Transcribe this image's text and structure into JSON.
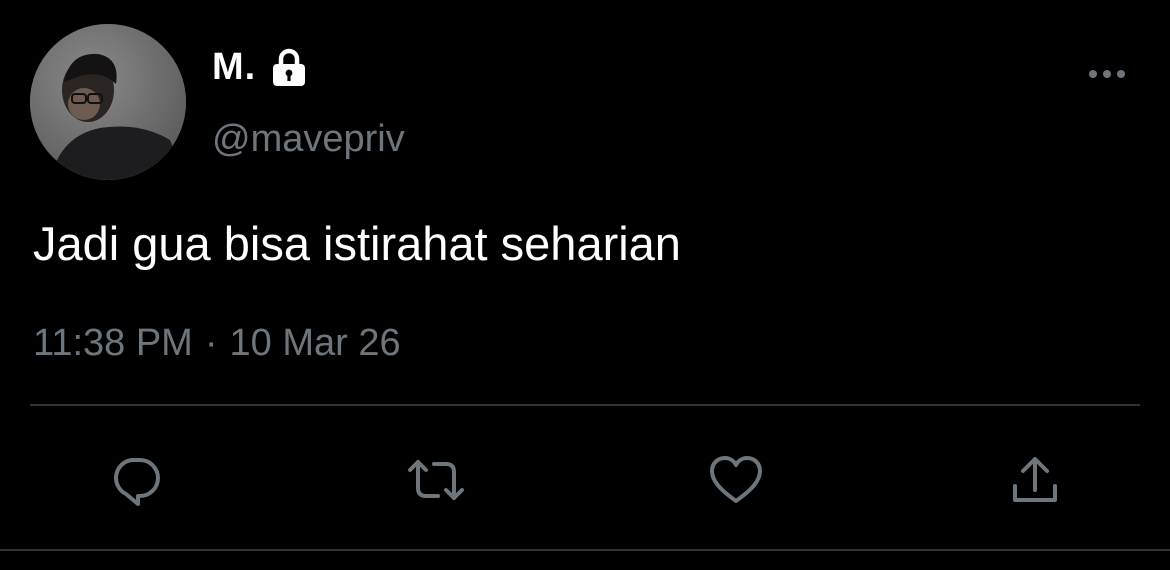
{
  "tweet": {
    "display_name": "M.",
    "handle": "@mavepriv",
    "text": "Jadi gua bisa istirahat seharian",
    "time": "11:38 PM",
    "separator": "·",
    "date": "10 Mar 26",
    "protected": true
  },
  "icons": {
    "lock": "lock-icon",
    "more": "more-horizontal-icon",
    "reply": "reply-icon",
    "retweet": "retweet-icon",
    "like": "heart-icon",
    "share": "share-icon"
  },
  "colors": {
    "background": "#000000",
    "primary_text": "#ffffff",
    "secondary_text": "#6e767d",
    "divider": "#2f3336"
  }
}
